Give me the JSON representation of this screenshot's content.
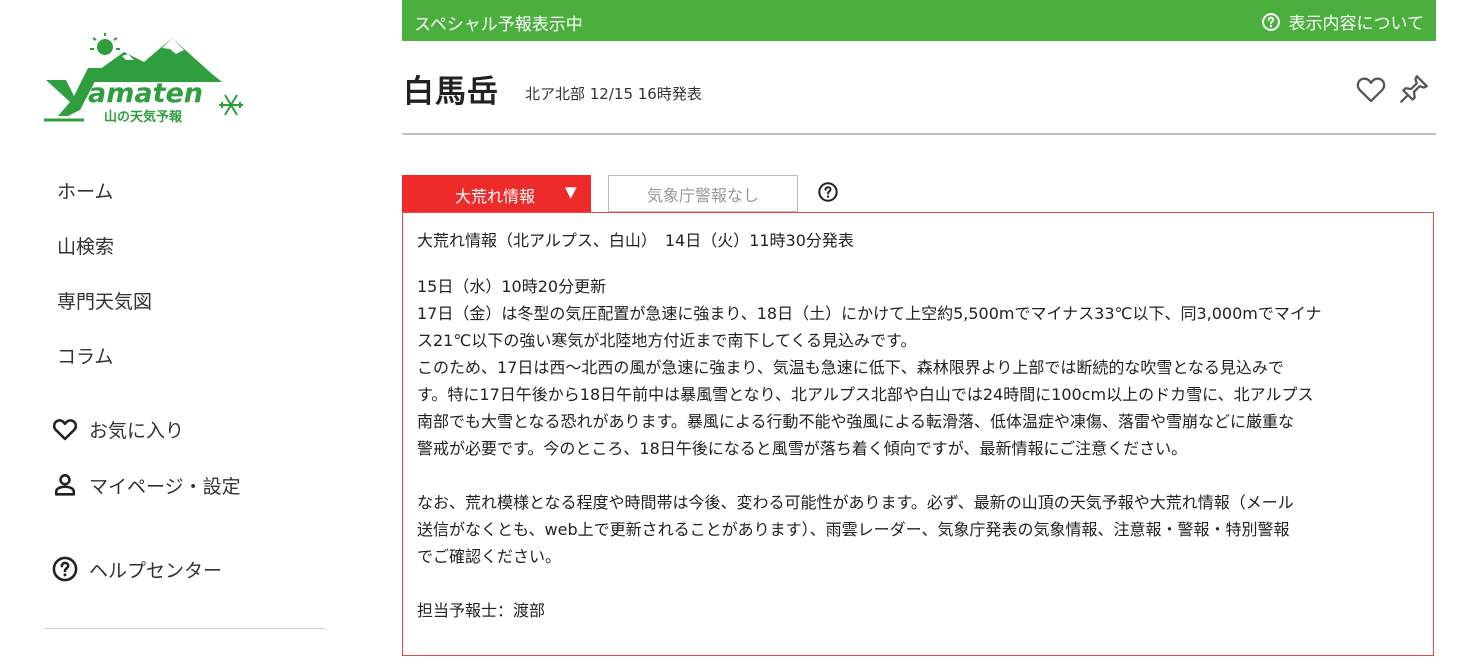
{
  "logo": {
    "name": "Yamaten",
    "wordmark": "amaten",
    "tagline": "山の天気予報",
    "colors": {
      "green": "#2e9e3e",
      "dark_green": "#1f7a30",
      "sun": "#2e9e3e"
    }
  },
  "sidebar": {
    "items": [
      {
        "label": "ホーム"
      },
      {
        "label": "山検索"
      },
      {
        "label": "専門天気図"
      },
      {
        "label": "コラム"
      },
      {
        "label": "お気に入り",
        "icon": "heart-icon"
      },
      {
        "label": "マイページ・設定",
        "icon": "person-icon"
      },
      {
        "label": "ヘルプセンター",
        "icon": "help-circle-icon"
      }
    ]
  },
  "banner": {
    "text": "スペシャル予報表示中",
    "about": "表示内容について",
    "color": "#4aaf3d"
  },
  "header": {
    "title": "白馬岳",
    "subtitle": "北ア北部 12/15 16時発表"
  },
  "tabs": {
    "storm": {
      "label": "大荒れ情報",
      "arrow": "▼",
      "color": "#ee2b2b"
    },
    "jma": {
      "label": "気象庁警報なし"
    }
  },
  "warning": {
    "heading": "大荒れ情報（北アルプス、白山）　14日（火）11時30分発表",
    "updated": "15日（水）10時20分更新",
    "p1_l1": "17日（金）は冬型の気圧配置が急速に強まり、18日（土）にかけて上空約5,500mでマイナス33℃以下、同3,000mでマイナ",
    "p1_l2": "ス21℃以下の強い寒気が北陸地方付近まで南下してくる見込みです。",
    "p2_l1": "このため、17日は西～北西の風が急速に強まり、気温も急速に低下、森林限界より上部では断続的な吹雪となる見込みで",
    "p2_l2": "す。特に17日午後から18日午前中は暴風雪となり、北アルプス北部や白山では24時間に100cm以上のドカ雪に、北アルプス",
    "p2_l3": "南部でも大雪となる恐れがあります。暴風による行動不能や強風による転滑落、低体温症や凍傷、落雷や雪崩などに厳重な",
    "p2_l4": "警戒が必要です。今のところ、18日午後になると風雪が落ち着く傾向ですが、最新情報にご注意ください。",
    "p3_l1": "なお、荒れ模様となる程度や時間帯は今後、変わる可能性があります。必ず、最新の山頂の天気予報や大荒れ情報（メール",
    "p3_l2": "送信がなくとも、web上で更新されることがあります）、雨雲レーダー、気象庁発表の気象情報、注意報・警報・特別警報",
    "p3_l3": "でご確認ください。",
    "forecaster": "担当予報士：渡部",
    "border_color": "#e84a4a"
  }
}
